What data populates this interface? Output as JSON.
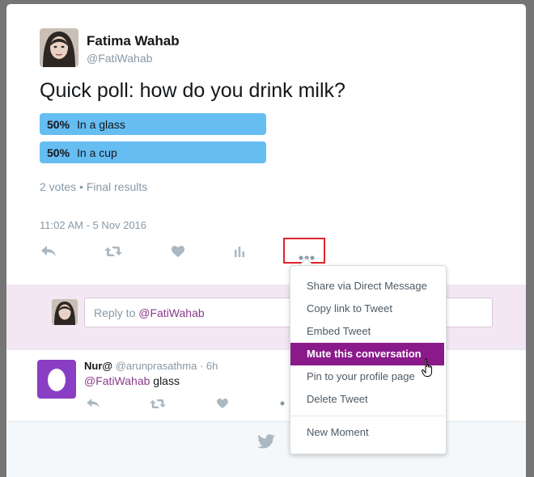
{
  "tweet": {
    "author_name": "Fatima Wahab",
    "author_handle": "@FatiWahab",
    "text": "Quick poll: how do you drink milk?",
    "poll": {
      "options": [
        {
          "percent": "50%",
          "label": "In a glass",
          "share": 0.5
        },
        {
          "percent": "50%",
          "label": "In a cup",
          "share": 0.5
        }
      ],
      "summary": "2 votes • Final results"
    },
    "timestamp": "11:02 AM - 5 Nov 2016",
    "actions": [
      "reply-icon",
      "retweet-icon",
      "like-icon",
      "analytics-icon",
      "more-icon"
    ]
  },
  "reply_box": {
    "placeholder_prefix": "Reply to ",
    "placeholder_mention": "@FatiWahab"
  },
  "reply": {
    "name": "Nur@",
    "handle_time": "@arunprasathma · 6h",
    "mention": "@FatiWahab",
    "text": " glass"
  },
  "menu": {
    "items": [
      "Share via Direct Message",
      "Copy link to Tweet",
      "Embed Tweet",
      "Mute this conversation",
      "Pin to your profile page",
      "Delete Tweet",
      "New Moment"
    ],
    "active_index": 3
  },
  "colors": {
    "poll_bar": "#66bdf2",
    "highlight_box": "#e0242c",
    "menu_active": "#8a1a8a",
    "reply_bg": "#f3e7f3",
    "mention": "#8a3a8a"
  }
}
